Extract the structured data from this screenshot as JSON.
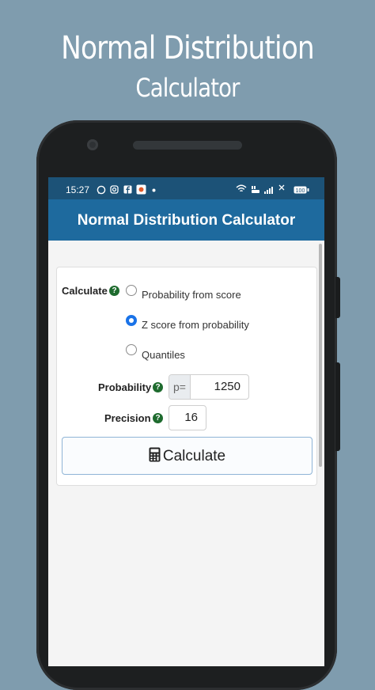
{
  "promo": {
    "title": "Normal Distribution",
    "subtitle": "Calculator"
  },
  "status_bar": {
    "time": "15:27",
    "left_icons": [
      "whatsapp-icon",
      "instagram-icon",
      "facebook-icon",
      "app-notification-icon",
      "dot-icon"
    ],
    "right_icons": [
      "wifi-icon",
      "volte-icon",
      "signal-icon",
      "battery-icon"
    ],
    "battery_level": "100"
  },
  "app_bar": {
    "title": "Normal Distribution Calculator"
  },
  "form": {
    "calculate_label": "Calculate",
    "help_glyph": "?",
    "options": [
      {
        "label": "Probability from score",
        "selected": false
      },
      {
        "label": "Z score from probability",
        "selected": true
      },
      {
        "label": "Quantiles",
        "selected": false
      }
    ],
    "probability_label": "Probability",
    "probability_prefix": "p=",
    "probability_value": "1250",
    "precision_label": "Precision",
    "precision_value": "16",
    "calculate_button": "Calculate"
  },
  "colors": {
    "background": "#7f9cae",
    "status_bar": "#1c5277",
    "app_bar": "#1e6a9e",
    "help_badge": "#1e6b2e",
    "radio_selected": "#1a73e8"
  }
}
